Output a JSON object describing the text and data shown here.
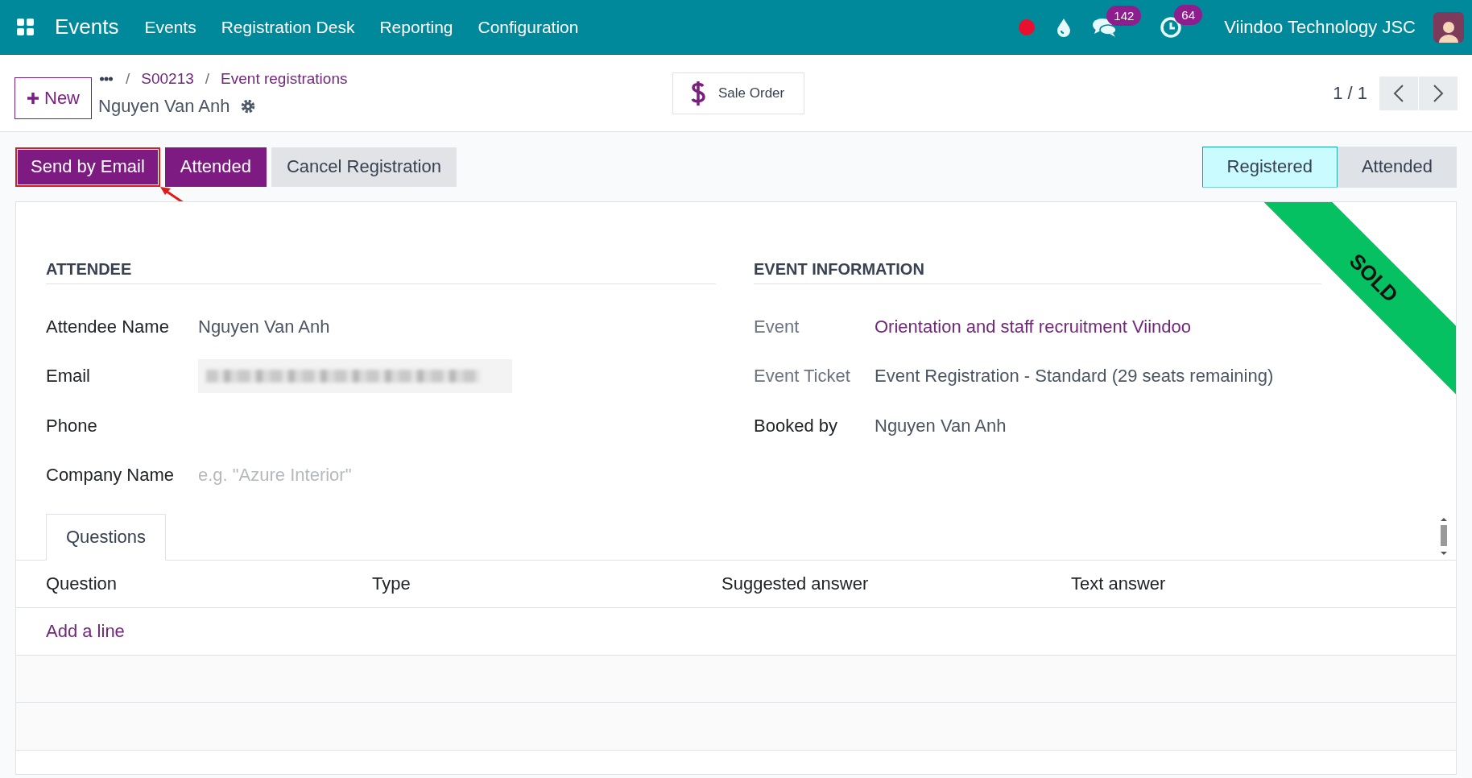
{
  "navbar": {
    "app_name": "Events",
    "menu": [
      {
        "label": "Events"
      },
      {
        "label": "Registration Desk"
      },
      {
        "label": "Reporting"
      },
      {
        "label": "Configuration"
      }
    ],
    "systray": [
      {
        "kind": "record-dot"
      },
      {
        "kind": "drop"
      },
      {
        "kind": "chat",
        "badge": "142"
      },
      {
        "kind": "clock",
        "badge": "64"
      }
    ],
    "company": "Viindoo Technology JSC"
  },
  "control_panel": {
    "new_button": "New",
    "breadcrumbs": [
      {
        "separator": "/",
        "label": "S00213"
      },
      {
        "separator": "/",
        "label": "Event registrations"
      }
    ],
    "record_title": "Nguyen Van Anh",
    "smart_button": "Sale Order",
    "pager": "1 / 1"
  },
  "actions": [
    {
      "label": "Send by Email",
      "primary": true,
      "highlighted": true
    },
    {
      "label": "Attended",
      "primary": true,
      "highlighted": false
    },
    {
      "label": "Cancel Registration",
      "primary": false,
      "highlighted": false
    }
  ],
  "statusbar": [
    {
      "label": "Registered",
      "selected": true
    },
    {
      "label": "Attended",
      "selected": false
    }
  ],
  "ribbon": "SOLD",
  "groups": [
    {
      "title": "ATTENDEE",
      "fields": [
        {
          "label": "Attendee Name",
          "kind": "text",
          "value": "Nguyen Van Anh"
        },
        {
          "label": "Email",
          "kind": "redacted"
        },
        {
          "label": "Phone",
          "kind": "text"
        },
        {
          "label": "Company Name",
          "kind": "text",
          "placeholder": "e.g. \"Azure Interior\""
        }
      ]
    },
    {
      "title": "EVENT INFORMATION",
      "fields": [
        {
          "label": "Event",
          "kind": "link",
          "value": "Orientation and staff recruitment Viindoo",
          "muted": true
        },
        {
          "label": "Event Ticket",
          "kind": "text",
          "value": "Event Registration - Standard (29 seats remaining)",
          "muted": true
        },
        {
          "label": "Booked by",
          "kind": "text",
          "value": "Nguyen Van Anh",
          "muted": false
        }
      ]
    }
  ],
  "notebook": {
    "tabs": [
      {
        "label": "Questions",
        "selected": true
      }
    ],
    "columns": [
      "Question",
      "Type",
      "Suggested answer",
      "Text answer"
    ],
    "add_line": "Add a line"
  }
}
